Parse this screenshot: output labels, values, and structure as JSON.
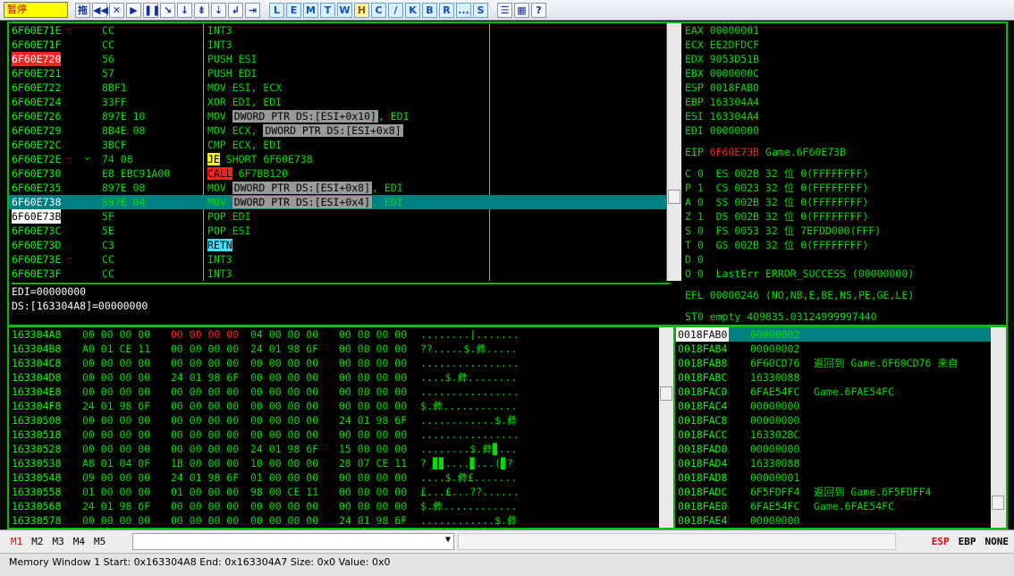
{
  "toolbar": {
    "status": "暂停",
    "buttons": [
      "拖",
      "◀◀",
      "✕",
      "▶",
      "❚❚",
      "↘",
      "↓",
      "⇟",
      "⇣",
      "↲",
      "⇥"
    ],
    "letters": [
      "L",
      "E",
      "M",
      "T",
      "W",
      "H",
      "C",
      "/",
      "K",
      "B",
      "R",
      "...",
      "S"
    ],
    "extras": [
      "☰",
      "▦",
      "?"
    ]
  },
  "disasm": {
    "rows": [
      {
        "addr": "6F60E71E",
        "hex": "CC",
        "asm": "INT3"
      },
      {
        "addr": "6F60E71F",
        "hex": "CC",
        "asm": "INT3"
      },
      {
        "addr": "6F60E720",
        "hex": "56",
        "asm": "PUSH ESI"
      },
      {
        "addr": "6F60E721",
        "hex": "57",
        "asm": "PUSH EDI"
      },
      {
        "addr": "6F60E722",
        "hex": "8BF1",
        "asm": "MOV ESI, ECX"
      },
      {
        "addr": "6F60E724",
        "hex": "33FF",
        "asm": "XOR EDI, EDI"
      },
      {
        "addr": "6F60E726",
        "hex": "897E 10",
        "asm_op": "MOV ",
        "asm_mem": "DWORD PTR DS:[ESI+0x10]",
        "asm_tail": ", EDI"
      },
      {
        "addr": "6F60E729",
        "hex": "8B4E 08",
        "asm_op": "MOV ECX, ",
        "asm_mem": "DWORD PTR DS:[ESI+0x8]",
        "asm_tail": ""
      },
      {
        "addr": "6F60E72C",
        "hex": "3BCF",
        "asm": "CMP ECX, EDI"
      },
      {
        "addr": "6F60E72E",
        "hex": "74 08",
        "asm_kw": "JE",
        "asm_rest": " SHORT 6F60E738"
      },
      {
        "addr": "6F60E730",
        "hex": "E8 EBC91A00",
        "asm_kw": "CALL",
        "asm_rest": " 6F7BB120"
      },
      {
        "addr": "6F60E735",
        "hex": "897E 08",
        "asm_op": "MOV ",
        "asm_mem": "DWORD PTR DS:[ESI+0x8]",
        "asm_tail": ", EDI"
      },
      {
        "addr": "6F60E738",
        "hex": "897E 04",
        "asm_op": "MOV ",
        "asm_mem": "DWORD PTR DS:[ESI+0x4]",
        "asm_tail": ", EDI"
      },
      {
        "addr": "6F60E73B",
        "hex": "5F",
        "asm": "POP EDI"
      },
      {
        "addr": "6F60E73C",
        "hex": "5E",
        "asm": "POP ESI"
      },
      {
        "addr": "6F60E73D",
        "hex": "C3",
        "asm_kw": "RETN",
        "asm_rest": ""
      },
      {
        "addr": "6F60E73E",
        "hex": "CC",
        "asm": "INT3"
      },
      {
        "addr": "6F60E73F",
        "hex": "CC",
        "asm": "INT3"
      }
    ],
    "jump_mark": "⌄"
  },
  "info": {
    "line1": "EDI=00000000",
    "line2": "DS:[163304A8]=00000000"
  },
  "registers": {
    "gp": [
      "EAX 00000001",
      "ECX EE2DFDCF",
      "EDX 9053D51B",
      "EBX 0000000C",
      "ESP 0018FAB0",
      "EBP 163304A4",
      "ESI 163304A4",
      "EDI 00000000"
    ],
    "eip_label": "EIP ",
    "eip_value": "6F60E73B",
    "eip_sym": " Game.6F60E73B",
    "flags": [
      "C 0  ES 002B 32 位 0(FFFFFFFF)",
      "P 1  CS 0023 32 位 0(FFFFFFFF)",
      "A 0  SS 002B 32 位 0(FFFFFFFF)",
      "Z 1  DS 002B 32 位 0(FFFFFFFF)",
      "S 0  FS 0053 32 位 7EFDD000(FFF)",
      "T 0  GS 002B 32 位 0(FFFFFFFF)",
      "D 0",
      "O 0  LastErr ERROR_SUCCESS (00000000)"
    ],
    "efl": "EFL 00000246 (NO,NB,E,BE,NS,PE,GE,LE)",
    "st0": "ST0 empty 409835.03124999997440"
  },
  "dump": {
    "rows": [
      {
        "addr": "163304A8",
        "hex1": "00 00 00 00",
        "hex2": "00 00 00 00",
        "hex3": "04 00 00 00",
        "hex4": "00 00 00 00",
        "ascii": "........|......."
      },
      {
        "addr": "163304B8",
        "hex1": "A0 01 CE 11",
        "hex2": "00 00 00 00",
        "hex3": "24 01 98 6F",
        "hex4": "00 00 00 00",
        "ascii": "??.....$.彝....."
      },
      {
        "addr": "163304C8",
        "hex1": "00 00 00 00",
        "hex2": "00 00 00 00",
        "hex3": "00 00 00 00",
        "hex4": "00 00 00 00",
        "ascii": "................"
      },
      {
        "addr": "163304D8",
        "hex1": "00 00 00 00",
        "hex2": "24 01 98 6F",
        "hex3": "00 00 00 00",
        "hex4": "00 00 00 00",
        "ascii": "....$.彝........"
      },
      {
        "addr": "163304E8",
        "hex1": "00 00 00 00",
        "hex2": "00 00 00 00",
        "hex3": "00 00 00 00",
        "hex4": "00 00 00 00",
        "ascii": "................"
      },
      {
        "addr": "163304F8",
        "hex1": "24 01 98 6F",
        "hex2": "00 00 00 00",
        "hex3": "00 00 00 00",
        "hex4": "00 00 00 00",
        "ascii": "$.彝............"
      },
      {
        "addr": "16330508",
        "hex1": "00 00 00 00",
        "hex2": "00 00 00 00",
        "hex3": "00 00 00 00",
        "hex4": "24 01 98 6F",
        "ascii": "............$.彝"
      },
      {
        "addr": "16330518",
        "hex1": "00 00 00 00",
        "hex2": "00 00 00 00",
        "hex3": "00 00 00 00",
        "hex4": "00 00 00 00",
        "ascii": "................"
      },
      {
        "addr": "16330528",
        "hex1": "00 00 00 00",
        "hex2": "00 00 00 00",
        "hex3": "24 01 98 6F",
        "hex4": "15 00 00 00",
        "ascii": "........$.彝▊..."
      },
      {
        "addr": "16330538",
        "hex1": "A8 01 04 0F",
        "hex2": "1B 00 00 00",
        "hex3": "10 00 00 00",
        "hex4": "28 07 CE 11",
        "ascii": "? ▊▊....▊...(▊?"
      },
      {
        "addr": "16330548",
        "hex1": "09 00 00 00",
        "hex2": "24 01 98 6F",
        "hex3": "01 00 00 00",
        "hex4": "00 00 00 00",
        "ascii": "....$.彝£......."
      },
      {
        "addr": "16330558",
        "hex1": "01 00 00 00",
        "hex2": "01 00 00 00",
        "hex3": "98 00 CE 11",
        "hex4": "00 00 00 00",
        "ascii": "£...£...??......"
      },
      {
        "addr": "16330568",
        "hex1": "24 01 98 6F",
        "hex2": "00 00 00 00",
        "hex3": "00 00 00 00",
        "hex4": "00 00 00 00",
        "ascii": "$.彝............"
      },
      {
        "addr": "16330578",
        "hex1": "00 00 00 00",
        "hex2": "00 00 00 00",
        "hex3": "00 00 00 00",
        "hex4": "24 01 98 6F",
        "ascii": "............$.彝"
      }
    ]
  },
  "stack": {
    "rows": [
      {
        "addr": "0018FAB0",
        "val": "00000002",
        "note": ""
      },
      {
        "addr": "0018FAB4",
        "val": "00000002",
        "note": ""
      },
      {
        "addr": "0018FAB8",
        "val": "6F60CD76",
        "note": "返回到 Game.6F60CD76 来自"
      },
      {
        "addr": "0018FABC",
        "val": "16330088",
        "note": ""
      },
      {
        "addr": "0018FAC0",
        "val": "6FAE54FC",
        "note": "Game.6FAE54FC"
      },
      {
        "addr": "0018FAC4",
        "val": "00000000",
        "note": ""
      },
      {
        "addr": "0018FAC8",
        "val": "00000000",
        "note": ""
      },
      {
        "addr": "0018FACC",
        "val": "163302BC",
        "note": ""
      },
      {
        "addr": "0018FAD0",
        "val": "00000000",
        "note": ""
      },
      {
        "addr": "0018FAD4",
        "val": "16330088",
        "note": ""
      },
      {
        "addr": "0018FAD8",
        "val": "00000001",
        "note": ""
      },
      {
        "addr": "0018FADC",
        "val": "6F5FDFF4",
        "note": "返回到 Game.6F5FDFF4"
      },
      {
        "addr": "0018FAE0",
        "val": "6FAE54FC",
        "note": "Game.6FAE54FC"
      },
      {
        "addr": "0018FAE4",
        "val": "00000000",
        "note": ""
      }
    ]
  },
  "bottom": {
    "mem_tabs": [
      "M1",
      "M2",
      "M3",
      "M4",
      "M5"
    ],
    "dropdown_arrow": "▼",
    "right": [
      "ESP",
      "EBP",
      "NONE"
    ]
  },
  "status": {
    "text": "Memory Window 1 Start: 0x163304A8 End: 0x163304A7 Size: 0x0 Value: 0x0"
  },
  "colors": {
    "accent": "#008080",
    "border": "#00c000",
    "text": "#00e000"
  }
}
